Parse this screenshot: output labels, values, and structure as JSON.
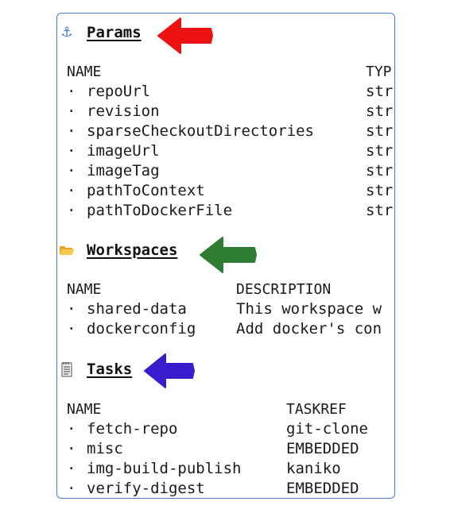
{
  "params": {
    "title": "Params",
    "icon": "anchor-icon",
    "arrow_color": "#ee1111",
    "headers": [
      "NAME",
      "TYP"
    ],
    "rows": [
      {
        "name": "repoUrl",
        "type": "str"
      },
      {
        "name": "revision",
        "type": "str"
      },
      {
        "name": "sparseCheckoutDirectories",
        "type": "str"
      },
      {
        "name": "imageUrl",
        "type": "str"
      },
      {
        "name": "imageTag",
        "type": "str"
      },
      {
        "name": "pathToContext",
        "type": "str"
      },
      {
        "name": "pathToDockerFile",
        "type": "str"
      }
    ]
  },
  "workspaces": {
    "title": "Workspaces",
    "icon": "folder-icon",
    "arrow_color": "#2e7d32",
    "headers": [
      "NAME",
      "DESCRIPTION"
    ],
    "rows": [
      {
        "name": "shared-data",
        "description": "This workspace w"
      },
      {
        "name": "dockerconfig",
        "description": "Add docker's con"
      }
    ]
  },
  "tasks": {
    "title": "Tasks",
    "icon": "notepad-icon",
    "arrow_color": "#3b1ccc",
    "headers": [
      "NAME",
      "TASKREF"
    ],
    "rows": [
      {
        "name": "fetch-repo",
        "taskref": "git-clone"
      },
      {
        "name": "misc",
        "taskref": "EMBEDDED"
      },
      {
        "name": "img-build-publish",
        "taskref": "kaniko"
      },
      {
        "name": "verify-digest",
        "taskref": "EMBEDDED"
      }
    ]
  },
  "bullet": "·"
}
